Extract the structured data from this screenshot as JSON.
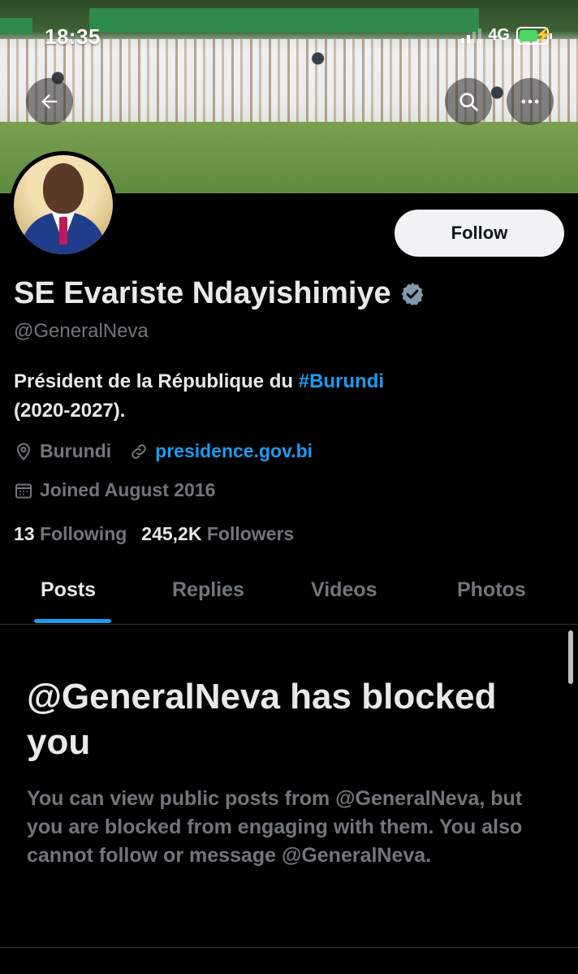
{
  "status_bar": {
    "time": "18:35",
    "network": "4G"
  },
  "banner": {
    "description_icon": "banner-photo"
  },
  "header_actions": {
    "back_icon": "arrow-left-icon",
    "search_icon": "search-icon",
    "more_icon": "more-horizontal-icon"
  },
  "profile": {
    "follow_label": "Follow",
    "name": "SE Evariste Ndayishimiye",
    "handle": "@GeneralNeva",
    "bio_text": "Président de la République du ",
    "bio_hashtag": "#Burundi",
    "bio_end": "(2020-2027).",
    "location": "Burundi",
    "website": "presidence.gov.bi",
    "joined": "Joined August 2016",
    "following_count": "13",
    "following_label": "Following",
    "followers_count": "245,2K",
    "followers_label": "Followers"
  },
  "tabs": [
    {
      "label": "Posts",
      "active": true
    },
    {
      "label": "Replies",
      "active": false
    },
    {
      "label": "Videos",
      "active": false
    },
    {
      "label": "Photos",
      "active": false
    }
  ],
  "blocked": {
    "title": "@GeneralNeva has blocked you",
    "description": "You can view public posts from @GeneralNeva, but you are blocked from engaging with them. You also cannot follow or message @GeneralNeva."
  },
  "colors": {
    "accent": "#1d9bf0",
    "muted": "#71767b",
    "text": "#e7e9ea",
    "background": "#000000"
  }
}
